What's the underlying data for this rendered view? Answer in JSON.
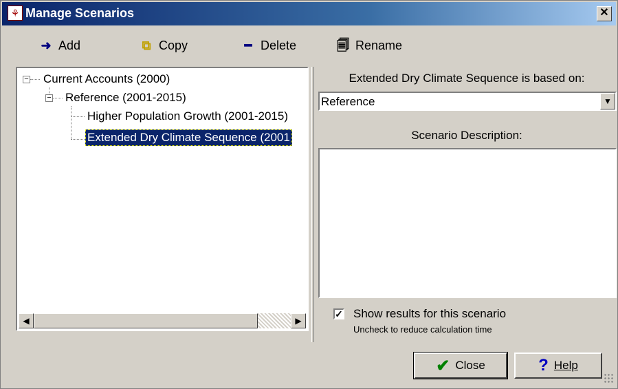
{
  "window": {
    "title": "Manage Scenarios",
    "close_glyph": "✕"
  },
  "toolbar": {
    "add_label": "Add",
    "copy_label": "Copy",
    "delete_label": "Delete",
    "rename_label": "Rename"
  },
  "tree": {
    "items": [
      {
        "label": "Current Accounts (2000)",
        "toggle": "−"
      },
      {
        "label": "Reference (2001-2015)",
        "toggle": "−"
      },
      {
        "label": "Higher Population Growth (2001-2015)"
      },
      {
        "label": "Extended Dry Climate Sequence (2001"
      }
    ]
  },
  "right": {
    "based_on_label": "Extended Dry Climate Sequence is based on:",
    "based_on_value": "Reference",
    "description_label": "Scenario Description:",
    "description_value": "",
    "show_results_label": "Show results for this scenario",
    "show_results_sub": "Uncheck to reduce calculation time",
    "show_results_checked": true
  },
  "buttons": {
    "close_label": "Close",
    "help_label": "Help"
  },
  "colors": {
    "titlebar_start": "#0a246a",
    "selection": "#0a246a",
    "face": "#d4d0c8"
  },
  "icons": [
    "app-icon",
    "add-icon",
    "copy-icon",
    "delete-icon",
    "rename-icon",
    "checkmark-icon",
    "help-icon"
  ]
}
